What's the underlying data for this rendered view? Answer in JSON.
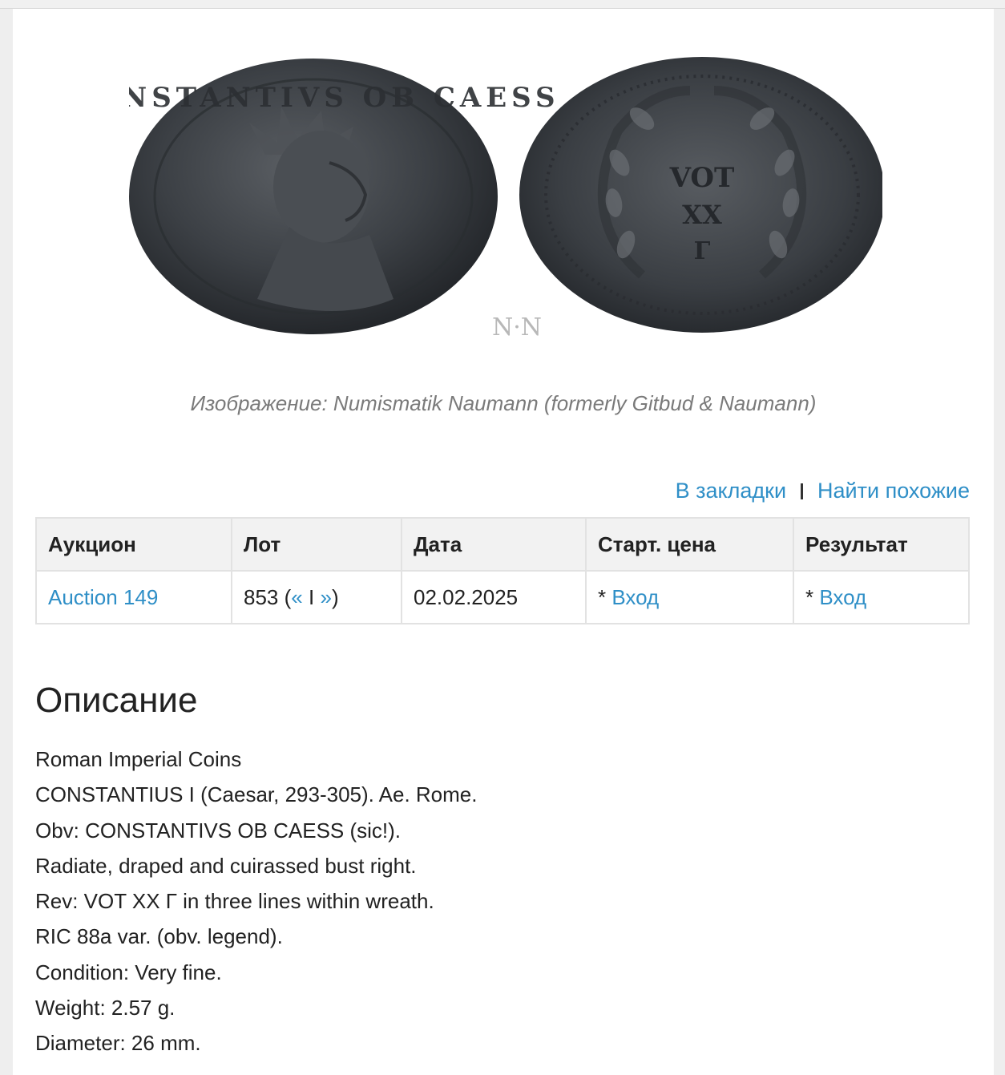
{
  "image": {
    "watermark": "N·N",
    "obverse_legend": "CONSTANTIVS OB CAESS",
    "reverse_lines": [
      "VOT",
      "XX",
      "Г"
    ]
  },
  "caption": "Изображение: Numismatik Naumann (formerly Gitbud & Naumann)",
  "actions": {
    "bookmark": "В закладки",
    "separator": "I",
    "find_similar": "Найти похожие"
  },
  "table": {
    "headers": [
      "Аукцион",
      "Лот",
      "Дата",
      "Старт. цена",
      "Результат"
    ],
    "row": {
      "auction": "Auction 149",
      "lot_number": "853",
      "lot_prev": "«",
      "lot_sep": "I",
      "lot_next": "»",
      "date": "02.02.2025",
      "start_price_prefix": "*",
      "start_price_link": "Вход",
      "result_prefix": "*",
      "result_link": "Вход"
    }
  },
  "description": {
    "title": "Описание",
    "lines": [
      "Roman Imperial Coins",
      "CONSTANTIUS I (Caesar, 293-305). Ae. Rome.",
      "Obv: CONSTANTIVS OB CAESS (sic!).",
      "Radiate, draped and cuirassed bust right.",
      "Rev: VOT XX Г in three lines within wreath.",
      "RIC 88a var. (obv. legend).",
      "Condition: Very fine.",
      "Weight: 2.57 g.",
      "Diameter: 26 mm."
    ]
  }
}
